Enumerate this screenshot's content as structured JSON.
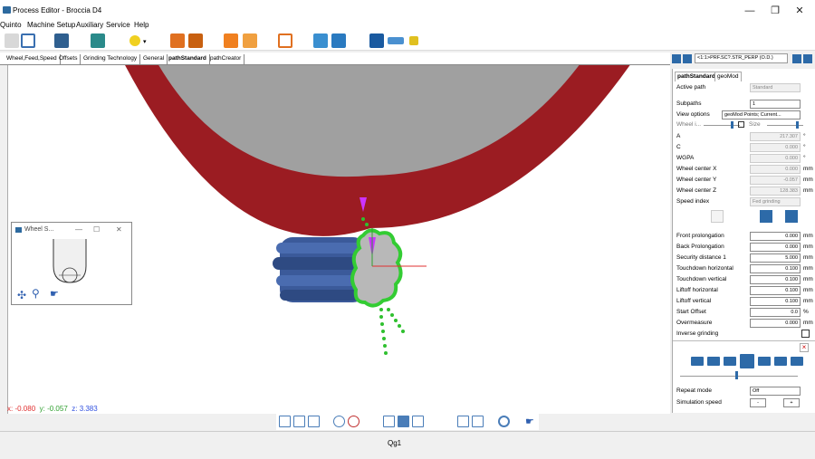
{
  "window": {
    "title": "Process Editor - Broccia D4",
    "minimize": "—",
    "maximize": "❐",
    "close": "✕"
  },
  "menu": [
    "Quinto",
    "Machine Setup",
    "Auxiliary",
    "Service",
    "Help"
  ],
  "tabs": [
    "Wheel,Feed,Speed",
    "Offsets",
    "Grinding Technology",
    "General",
    "pathStandard",
    "pathCreator"
  ],
  "active_tab": "pathStandard",
  "coords": {
    "x_label": "x:",
    "x": "-0.080",
    "y_label": "y:",
    "y": "-0.057",
    "z_label": "z:",
    "z": "3.383"
  },
  "mini_window": {
    "title": "Wheel S...",
    "minimize": "—",
    "maximize": "☐",
    "close": "✕"
  },
  "panel_header": {
    "path_combo": "<1:1>PRF.SC?.STR_PERP (O.D.)"
  },
  "panel": {
    "tabs": [
      "pathStandard",
      "geoMod"
    ],
    "active_path_label": "Active path",
    "active_path_value": "Standard",
    "subpaths_label": "Subpaths",
    "subpaths_value": "1",
    "view_options_label": "View options",
    "view_options_value": "geoMod Points; Current...",
    "wheel_label": "Wheel i...",
    "size_label": "Size",
    "fields": [
      {
        "label": "A",
        "value": "217.307",
        "unit": "°",
        "enabled": false
      },
      {
        "label": "C",
        "value": "0.000",
        "unit": "°",
        "enabled": false
      },
      {
        "label": "WGPA",
        "value": "0.000",
        "unit": "°",
        "enabled": false
      },
      {
        "label": "Wheel center X",
        "value": "0.000",
        "unit": "mm",
        "enabled": false
      },
      {
        "label": "Wheel center Y",
        "value": "-0.057",
        "unit": "mm",
        "enabled": false
      },
      {
        "label": "Wheel center Z",
        "value": "128.383",
        "unit": "mm",
        "enabled": false
      },
      {
        "label": "Speed index",
        "value": "Fed grinding",
        "unit": "",
        "enabled": false
      }
    ],
    "params": [
      {
        "label": "Front prolongation",
        "value": "0.000",
        "unit": "mm"
      },
      {
        "label": "Back Prolongation",
        "value": "0.000",
        "unit": "mm"
      },
      {
        "label": "Security distance 1",
        "value": "5.000",
        "unit": "mm"
      },
      {
        "label": "Touchdown horizontal",
        "value": "0.100",
        "unit": "mm"
      },
      {
        "label": "Touchdown vertical",
        "value": "0.100",
        "unit": "mm"
      },
      {
        "label": "Liftoff horizontal",
        "value": "0.100",
        "unit": "mm"
      },
      {
        "label": "Liftoff vertical",
        "value": "0.100",
        "unit": "mm"
      },
      {
        "label": "Start Offset",
        "value": "0.0",
        "unit": "%"
      },
      {
        "label": "Overmeasure",
        "value": "0.000",
        "unit": "mm"
      }
    ],
    "inverse_label": "Inverse grinding",
    "repeat_label": "Repeat mode",
    "repeat_value": "Off",
    "sim_speed_label": "Simulation speed",
    "minus": "-",
    "plus": "+",
    "close_x": "×"
  },
  "status": {
    "text": "Qg1"
  },
  "colors": {
    "wheel_red": "#9b1c22",
    "wheel_gray": "#a0a0a0",
    "tool_blue": "#3b5a9a",
    "path_green": "#33cc33",
    "magenta": "#cc33ff",
    "coords_x": "#e03030",
    "coords_y": "#30a030",
    "coords_z": "#3050e0"
  }
}
